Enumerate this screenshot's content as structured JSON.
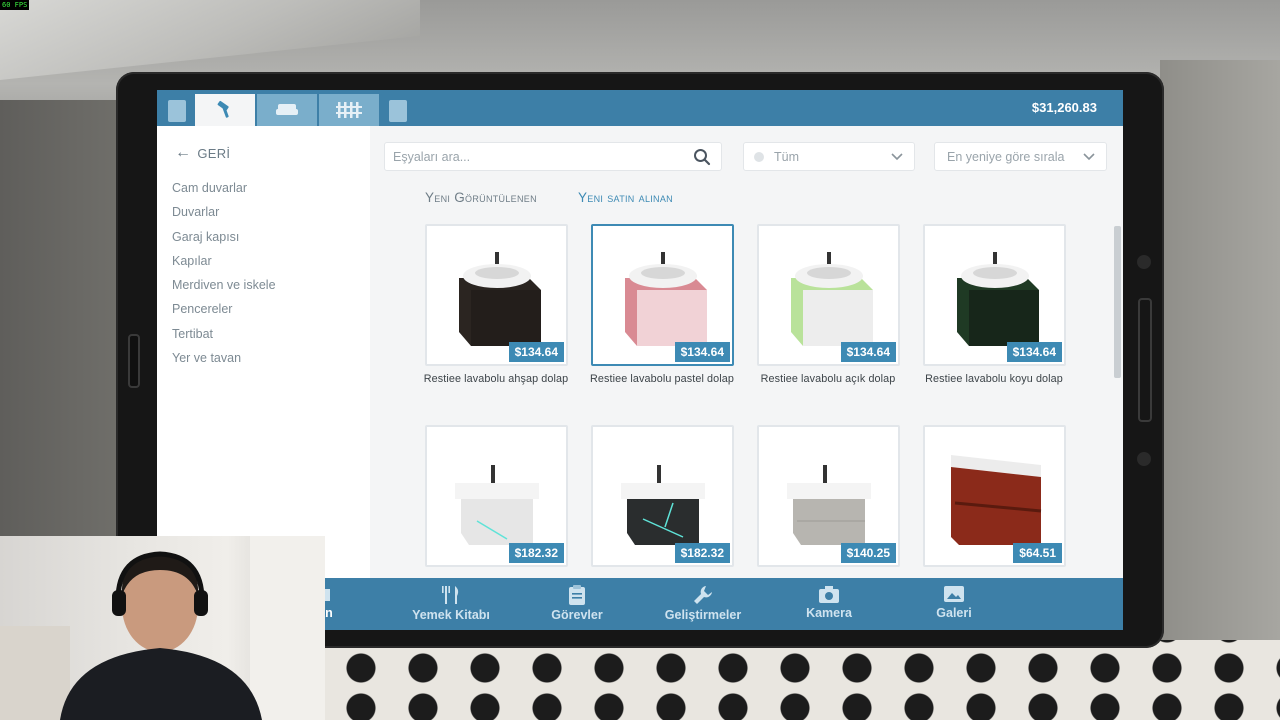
{
  "overlay": {
    "fps_label": "60 FPS"
  },
  "header": {
    "balance": "$31,260.83",
    "tabs": [
      {
        "icon": "hammer-icon"
      },
      {
        "icon": "sofa-icon"
      },
      {
        "icon": "fence-icon"
      }
    ]
  },
  "sidebar": {
    "back_label": "GERİ",
    "items": [
      {
        "label": "Cam duvarlar"
      },
      {
        "label": "Duvarlar"
      },
      {
        "label": "Garaj kapısı"
      },
      {
        "label": "Kapılar"
      },
      {
        "label": "Merdiven ve iskele"
      },
      {
        "label": "Pencereler"
      },
      {
        "label": "Tertibat"
      },
      {
        "label": "Yer ve tavan"
      }
    ]
  },
  "toolbar": {
    "search_placeholder": "Eşyaları ara...",
    "filter_value": "Tüm",
    "sort_value": "En yeniye göre sırala"
  },
  "subtabs": {
    "recently_viewed": "Yeni Görüntülenen",
    "recently_bought": "Yeni satın alınan"
  },
  "items": [
    {
      "name": "Restiee lavabolu ahşap dolap",
      "price": "$134.64",
      "color": "#2b2521"
    },
    {
      "name": "Restiee lavabolu pastel dolap",
      "price": "$134.64",
      "color": "#d98a93"
    },
    {
      "name": "Restiee lavabolu açık dolap",
      "price": "$134.64",
      "color": "#b9e29a"
    },
    {
      "name": "Restiee lavabolu koyu dolap",
      "price": "$134.64",
      "color": "#1f3a24"
    },
    {
      "name": "",
      "price": "$182.32",
      "color": "#e6e6e6"
    },
    {
      "name": "",
      "price": "$182.32",
      "color": "#2a2d2e"
    },
    {
      "name": "",
      "price": "$140.25",
      "color": "#b7b5b0"
    },
    {
      "name": "",
      "price": "$64.51",
      "color": "#8b2a1a"
    }
  ],
  "bottom_nav": [
    {
      "label": "kân",
      "icon": "store-icon"
    },
    {
      "label": "Yemek Kitabı",
      "icon": "fork-knife-icon"
    },
    {
      "label": "Görevler",
      "icon": "clipboard-icon"
    },
    {
      "label": "Geliştirmeler",
      "icon": "wrench-icon"
    },
    {
      "label": "Kamera",
      "icon": "camera-icon"
    },
    {
      "label": "Galeri",
      "icon": "image-icon"
    }
  ]
}
